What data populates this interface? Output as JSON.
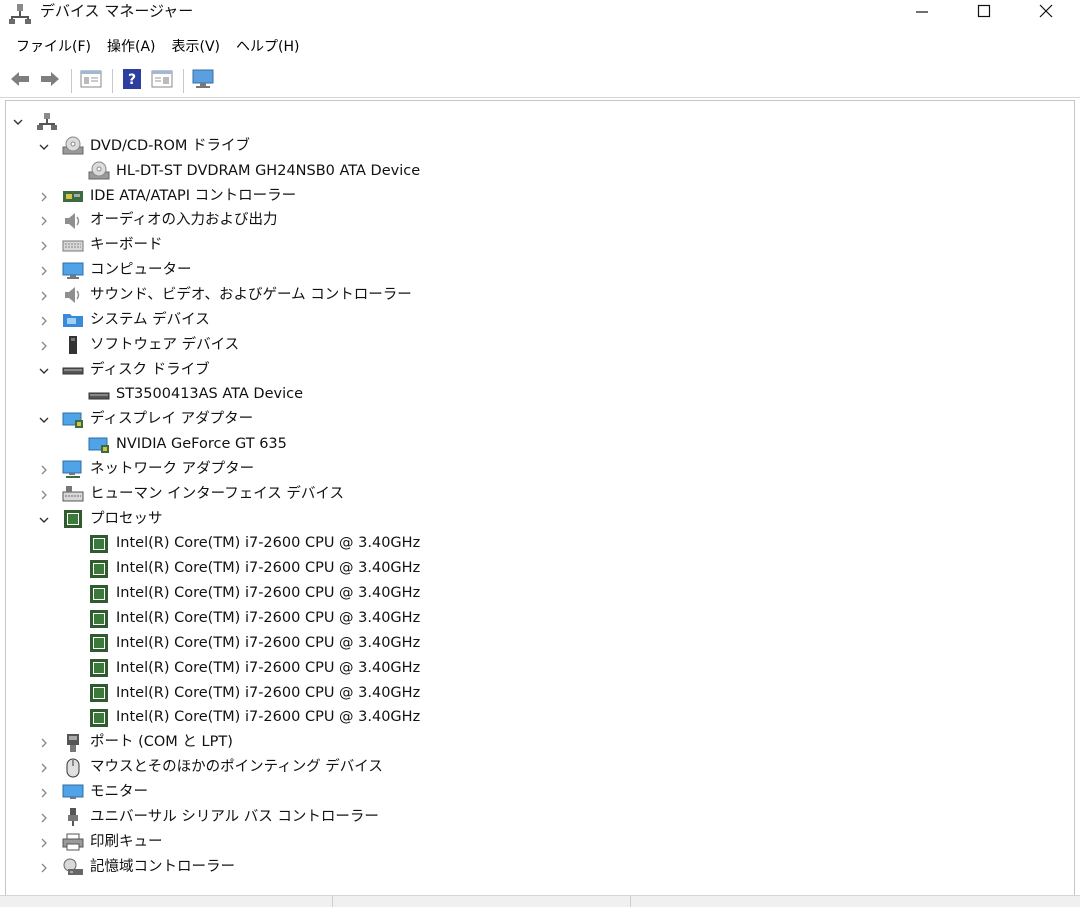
{
  "window": {
    "title": "デバイス マネージャー"
  },
  "menu": [
    {
      "label": "ファイル(F)"
    },
    {
      "label": "操作(A)"
    },
    {
      "label": "表示(V)"
    },
    {
      "label": "ヘルプ(H)"
    }
  ],
  "toolbar": {
    "buttons": [
      "back-arrow-icon",
      "forward-arrow-icon",
      "properties-icon",
      "help-icon",
      "view-icon",
      "monitor-computer-icon"
    ]
  },
  "tree": {
    "root_icon": "computer-root-icon",
    "items": [
      {
        "label": "DVD/CD-ROM ドライブ",
        "icon": "dvd-drive-icon",
        "expanded": true,
        "children": [
          "HL-DT-ST DVDRAM GH24NSB0 ATA Device"
        ]
      },
      {
        "label": "IDE ATA/ATAPI コントローラー",
        "icon": "ide-controller-icon",
        "expanded": false
      },
      {
        "label": "オーディオの入力および出力",
        "icon": "speaker-icon",
        "expanded": false
      },
      {
        "label": "キーボード",
        "icon": "keyboard-icon",
        "expanded": false
      },
      {
        "label": "コンピューター",
        "icon": "computer-icon",
        "expanded": false
      },
      {
        "label": "サウンド、ビデオ、およびゲーム コントローラー",
        "icon": "sound-icon",
        "expanded": false
      },
      {
        "label": "システム デバイス",
        "icon": "system-folder-icon",
        "expanded": false
      },
      {
        "label": "ソフトウェア デバイス",
        "icon": "software-device-icon",
        "expanded": false
      },
      {
        "label": "ディスク ドライブ",
        "icon": "disk-drive-icon",
        "expanded": true,
        "children": [
          "ST3500413AS ATA Device"
        ]
      },
      {
        "label": "ディスプレイ アダプター",
        "icon": "display-adapter-icon",
        "expanded": true,
        "children": [
          "NVIDIA GeForce GT 635"
        ]
      },
      {
        "label": "ネットワーク アダプター",
        "icon": "network-adapter-icon",
        "expanded": false
      },
      {
        "label": "ヒューマン インターフェイス デバイス",
        "icon": "hid-icon",
        "expanded": false
      },
      {
        "label": "プロセッサ",
        "icon": "processor-icon",
        "expanded": true,
        "children": [
          "Intel(R) Core(TM) i7-2600 CPU @ 3.40GHz",
          "Intel(R) Core(TM) i7-2600 CPU @ 3.40GHz",
          "Intel(R) Core(TM) i7-2600 CPU @ 3.40GHz",
          "Intel(R) Core(TM) i7-2600 CPU @ 3.40GHz",
          "Intel(R) Core(TM) i7-2600 CPU @ 3.40GHz",
          "Intel(R) Core(TM) i7-2600 CPU @ 3.40GHz",
          "Intel(R) Core(TM) i7-2600 CPU @ 3.40GHz",
          "Intel(R) Core(TM) i7-2600 CPU @ 3.40GHz"
        ]
      },
      {
        "label": "ポート (COM と LPT)",
        "icon": "port-icon",
        "expanded": false
      },
      {
        "label": "マウスとそのほかのポインティング デバイス",
        "icon": "mouse-icon",
        "expanded": false
      },
      {
        "label": "モニター",
        "icon": "monitor-icon",
        "expanded": false
      },
      {
        "label": "ユニバーサル シリアル バス コントローラー",
        "icon": "usb-icon",
        "expanded": false
      },
      {
        "label": "印刷キュー",
        "icon": "printer-icon",
        "expanded": false
      },
      {
        "label": "記憶域コントローラー",
        "icon": "storage-controller-icon",
        "expanded": false
      }
    ]
  }
}
